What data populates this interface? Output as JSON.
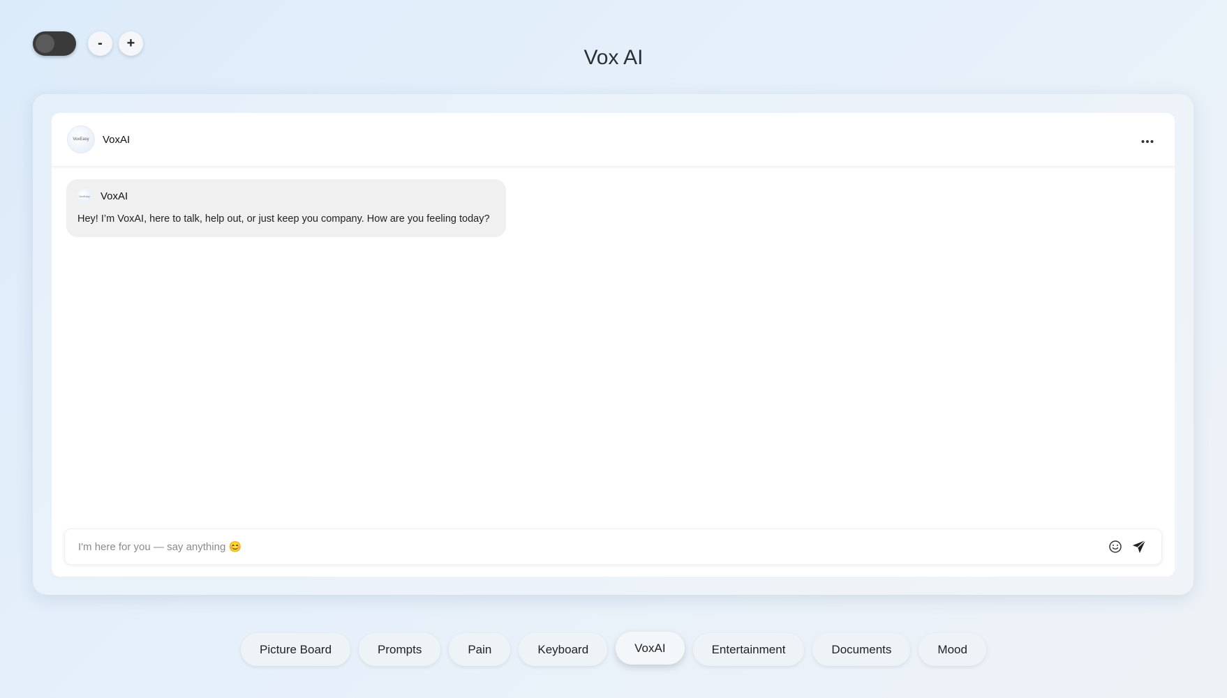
{
  "controls": {
    "zoom_out_label": "-",
    "zoom_in_label": "+",
    "theme_toggle_icon": "dark-mode-toggle"
  },
  "app": {
    "title": "Vox AI"
  },
  "chat": {
    "header": {
      "avatar_text": "VoxEasy",
      "name": "VoxAI",
      "more_icon": "more-horizontal-icon"
    },
    "messages": [
      {
        "sender": "VoxAI",
        "avatar_text": "VoxEasy",
        "text": "Hey! I’m VoxAI, here to talk, help out, or just keep you company. How are you feeling today?"
      }
    ],
    "input": {
      "placeholder": "I'm here for you — say anything 😊",
      "value": "",
      "emoji_icon": "smile-icon",
      "send_icon": "send-icon"
    }
  },
  "nav": {
    "tabs": [
      {
        "label": "Picture Board",
        "active": false
      },
      {
        "label": "Prompts",
        "active": false
      },
      {
        "label": "Pain",
        "active": false
      },
      {
        "label": "Keyboard",
        "active": false
      },
      {
        "label": "VoxAI",
        "active": true
      },
      {
        "label": "Entertainment",
        "active": false
      },
      {
        "label": "Documents",
        "active": false
      },
      {
        "label": "Mood",
        "active": false
      }
    ]
  }
}
